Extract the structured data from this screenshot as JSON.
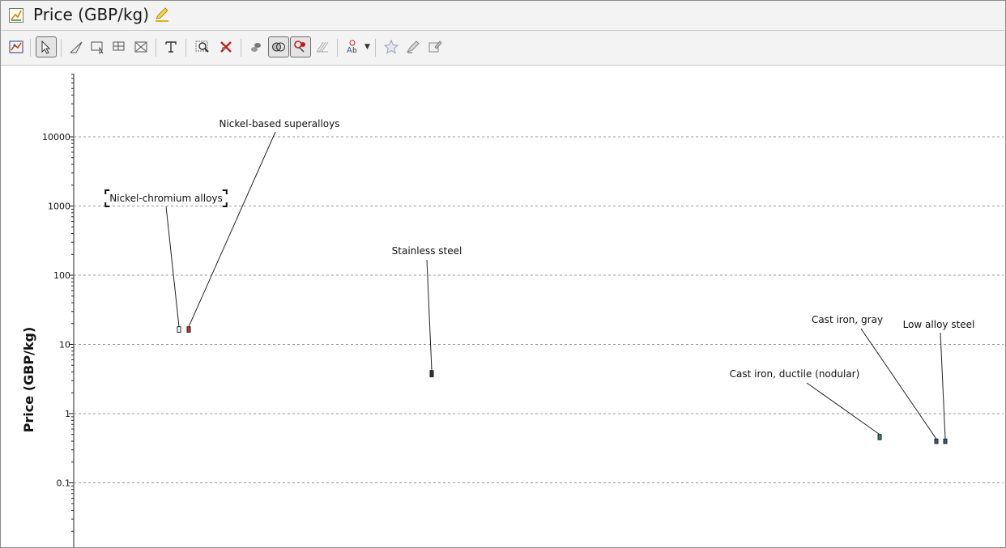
{
  "window": {
    "title": "Price (GBP/kg)"
  },
  "toolbar": {
    "buttons": [
      {
        "name": "chart-settings-icon",
        "icon": "chart-settings"
      },
      {
        "name": "select-icon",
        "icon": "pointer"
      },
      {
        "name": "draw-line-icon",
        "icon": "line-tool"
      },
      {
        "name": "select-box-icon",
        "icon": "box-select"
      },
      {
        "name": "select-grid-icon",
        "icon": "grid-select"
      },
      {
        "name": "delete-selection-icon",
        "icon": "box-delete"
      },
      {
        "name": "text-tool-icon",
        "icon": "text"
      },
      {
        "name": "zoom-icon",
        "icon": "zoom"
      },
      {
        "name": "clear-icon",
        "icon": "clear-x"
      },
      {
        "name": "hide-icon",
        "icon": "hide"
      },
      {
        "name": "envelope-icon",
        "icon": "envelope"
      },
      {
        "name": "lasso-icon",
        "icon": "lasso"
      },
      {
        "name": "hatch-icon",
        "icon": "hatch"
      },
      {
        "name": "label-options-icon",
        "icon": "labels"
      },
      {
        "name": "favorite-icon",
        "icon": "star"
      },
      {
        "name": "highlight-icon",
        "icon": "pencil-brush"
      },
      {
        "name": "note-icon",
        "icon": "note"
      }
    ],
    "active": [
      "select-icon",
      "envelope-icon",
      "lasso-icon"
    ]
  },
  "chart_data": {
    "type": "scatter",
    "ylabel": "Price (GBP/kg)",
    "yscale": "log",
    "ylim": [
      0.01,
      100000
    ],
    "yticks": [
      {
        "value": 0.1,
        "label": "0.1"
      },
      {
        "value": 1,
        "label": "1"
      },
      {
        "value": 10,
        "label": "10"
      },
      {
        "value": 100,
        "label": "100"
      },
      {
        "value": 1000,
        "label": "1000"
      },
      {
        "value": 10000,
        "label": "10000"
      }
    ],
    "grid": true,
    "x_axis": "unlabeled",
    "materials": [
      {
        "name": "Nickel-chromium alloys",
        "price_low": 15,
        "price_high": 18,
        "color": "#ffffff",
        "selected": true
      },
      {
        "name": "Nickel-based superalloys",
        "price_low": 15,
        "price_high": 18,
        "color": "#c0392b",
        "selected": false
      },
      {
        "name": "Stainless steel",
        "price_low": 3.4,
        "price_high": 4.2,
        "color": "#333333",
        "selected": false
      },
      {
        "name": "Cast iron, ductile (nodular)",
        "price_low": 0.42,
        "price_high": 0.5,
        "color": "#2e8b57",
        "selected": false
      },
      {
        "name": "Cast iron, gray",
        "price_low": 0.37,
        "price_high": 0.43,
        "color": "#3a5a8c",
        "selected": false
      },
      {
        "name": "Low alloy steel",
        "price_low": 0.37,
        "price_high": 0.43,
        "color": "#3a5a8c",
        "selected": false
      }
    ]
  }
}
